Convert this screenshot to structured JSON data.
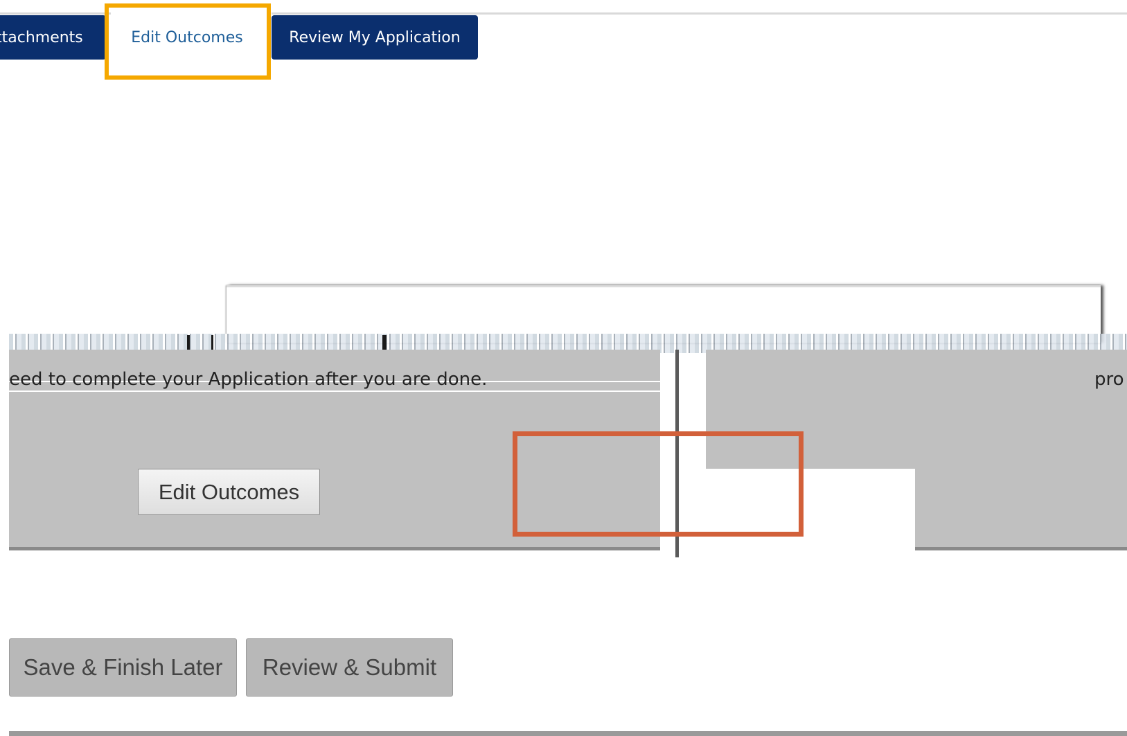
{
  "tabs": {
    "attachments_label": "ttachments",
    "edit_outcomes_label": "Edit Outcomes",
    "review_application_label": "Review My Application"
  },
  "panel": {
    "left_text": "eed to complete your Application after you are done.",
    "right_text": "pro",
    "edit_outcomes_button": "Edit Outcomes"
  },
  "actions": {
    "save_finish_later": "Save & Finish Later",
    "review_submit": "Review & Submit"
  },
  "colors": {
    "tab_dark": "#0b2f6e",
    "highlight_orange": "#f5a800",
    "highlight_red": "#d2603a",
    "panel_gray": "#c0c0c0"
  }
}
